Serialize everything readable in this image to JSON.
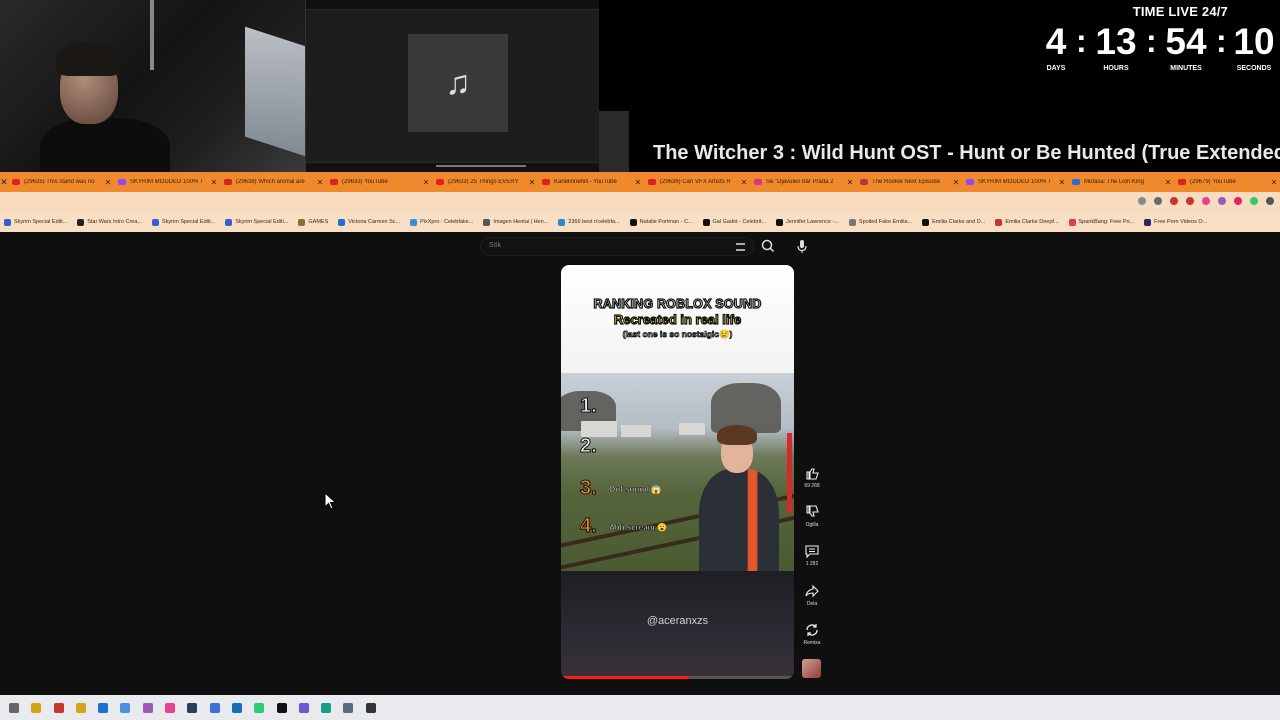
{
  "overlay": {
    "webcam_label": "Streamer webcam",
    "music_note": "♫",
    "timer": {
      "title": "TIME LIVE 24/7",
      "days": "4",
      "hours": "13",
      "minutes": "54",
      "seconds": "10",
      "days_label": "DAYS",
      "hours_label": "HOURS",
      "minutes_label": "MINUTES",
      "seconds_label": "SECONDS",
      "separator": ":"
    },
    "now_playing": "The Witcher 3 :  Wild Hunt OST - Hunt or Be Hunted (True Extended"
  },
  "browser": {
    "tabs": [
      {
        "label": "(29635) This stand was no",
        "color": "#e02020"
      },
      {
        "label": "SKYRIM MODDED 100% T",
        "color": "#9147ff"
      },
      {
        "label": "(29638) Which animal are",
        "color": "#e02020"
      },
      {
        "label": "(29633) YouTube",
        "color": "#e02020"
      },
      {
        "label": "(29633) 25 Things EVERY",
        "color": "#e02020"
      },
      {
        "label": "Kanelinnehill - YouTube",
        "color": "#e02020"
      },
      {
        "label": "(29636) Can VFX Artists R",
        "color": "#e02020"
      },
      {
        "label": "Se \"Djävulen bär Prada 2",
        "color": "#d9348c"
      },
      {
        "label": "The Rookie Next Episode",
        "color": "#b23b3b"
      },
      {
        "label": "SKYRIM MODDED 100% T",
        "color": "#9147ff"
      },
      {
        "label": "Mufasa: The Lion King",
        "color": "#2a6ad6"
      },
      {
        "label": "(29679) YouTube",
        "color": "#e02020"
      }
    ],
    "bookmarks": [
      {
        "label": "Skyrim Special Editi...",
        "color": "#3b5bd6"
      },
      {
        "label": "Star Wars Intro Crea...",
        "color": "#222222"
      },
      {
        "label": "Skyrim Special Editi...",
        "color": "#3b5bd6"
      },
      {
        "label": "Skyrim Special Editi...",
        "color": "#3b5bd6"
      },
      {
        "label": "GAMES",
        "color": "#8a6d3b"
      },
      {
        "label": "Victoria Carmen Sc...",
        "color": "#1f6fd1"
      },
      {
        "label": "PixXpro : Celebfake...",
        "color": "#3a8ed6"
      },
      {
        "label": "Imagen Hentai | Hen...",
        "color": "#555555"
      },
      {
        "label": "2366 best r/celebfa...",
        "color": "#2a8ad6"
      },
      {
        "label": "Natalie Portman - C...",
        "color": "#111111"
      },
      {
        "label": "Gal Gadot - Celebrit...",
        "color": "#111111"
      },
      {
        "label": "Jennifer Lawrence -...",
        "color": "#111111"
      },
      {
        "label": "Spoiled Fake Emilia...",
        "color": "#777777"
      },
      {
        "label": "Emilia Clarke and D...",
        "color": "#111111"
      },
      {
        "label": "Emilia Clarke Deepf...",
        "color": "#c0392b"
      },
      {
        "label": "SpankBang: Free Po...",
        "color": "#e03a5a"
      },
      {
        "label": "Free Porn Videos O...",
        "color": "#2a2a6a"
      }
    ]
  },
  "youtube": {
    "search_placeholder": "Sök",
    "short": {
      "caption_line1": "RANKING ROBLOX SOUND",
      "caption_line2": "Recreated in real life",
      "caption_line3": "(last one is so nostalgic😢)",
      "ranks": [
        "1.",
        "2.",
        "3.",
        "4."
      ],
      "rank_labels": {
        "3": "Oof sound 😱",
        "4": "Ahh scream 😮"
      },
      "handle": "@aceranxzs",
      "progress": 0.55
    },
    "actions": {
      "like_count": "69 268",
      "dislike_label": "Ogilla",
      "comment_count": "1 282",
      "share_label": "Dela",
      "remix_label": "Remixa"
    }
  },
  "taskbar_icons": [
    "#666666",
    "#d4a017",
    "#c0392b",
    "#d6a21c",
    "#1f6fd1",
    "#4a90e2",
    "#9b59b6",
    "#e84393",
    "#2c3e50",
    "#3b6ed6",
    "#1a6fb0",
    "#2ecc71",
    "#111111",
    "#6a5acd",
    "#16a085",
    "#5b6b7b",
    "#333333"
  ]
}
